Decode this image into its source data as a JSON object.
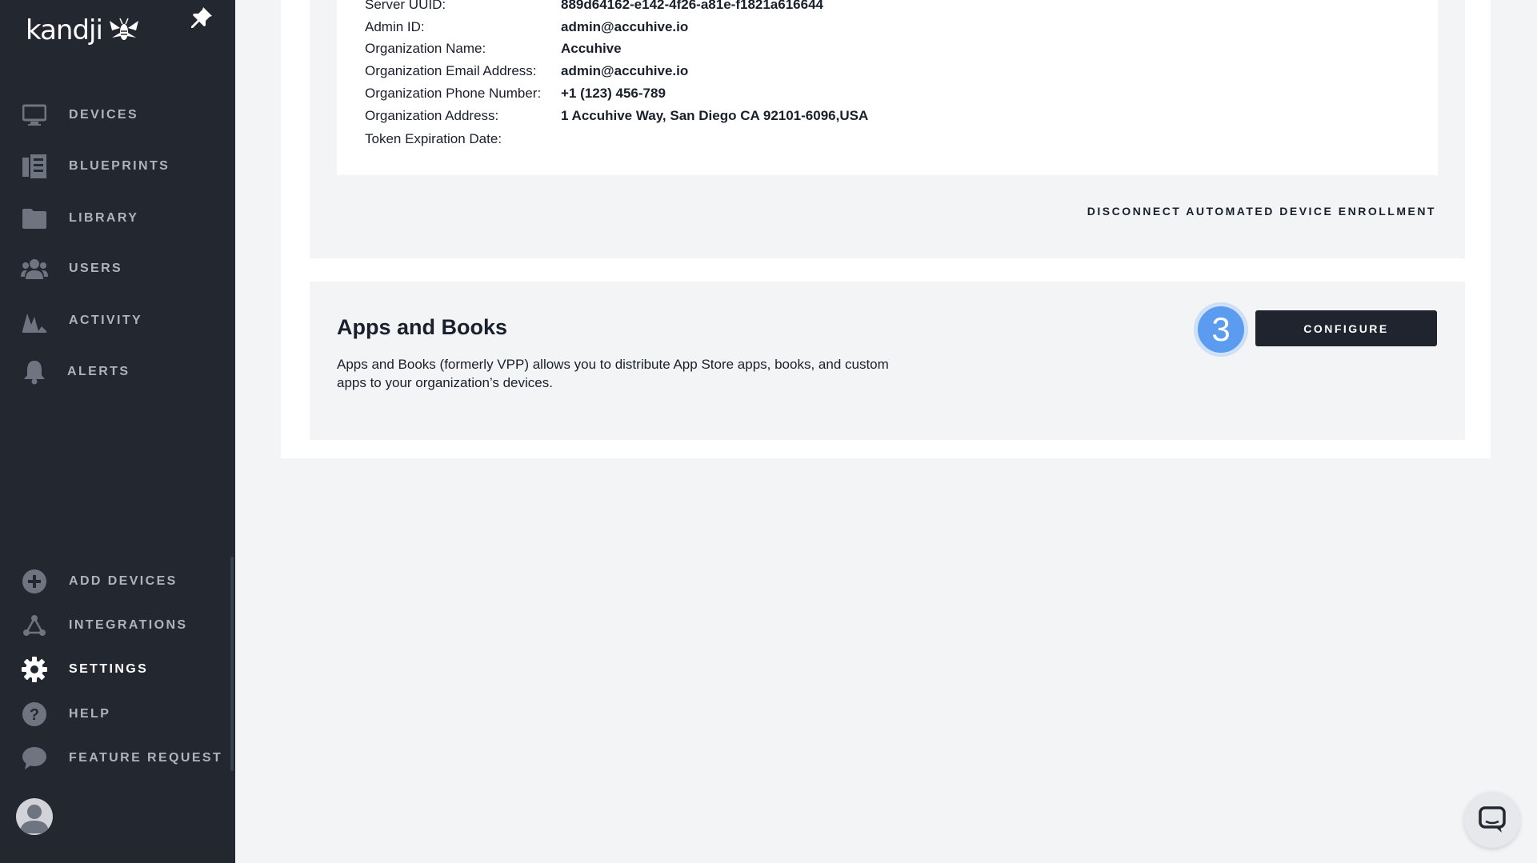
{
  "sidebar": {
    "logo_text": "kandji",
    "nav_top": [
      {
        "label": "Devices",
        "icon": "monitor-icon"
      },
      {
        "label": "Blueprints",
        "icon": "blueprints-icon"
      },
      {
        "label": "Library",
        "icon": "folder-icon"
      },
      {
        "label": "Users",
        "icon": "users-icon"
      },
      {
        "label": "Activity",
        "icon": "activity-icon"
      },
      {
        "label": "Alerts",
        "icon": "bell-icon"
      }
    ],
    "nav_bottom": [
      {
        "label": "Add Devices",
        "icon": "plus-circle-icon"
      },
      {
        "label": "Integrations",
        "icon": "integrations-icon"
      },
      {
        "label": "Settings",
        "icon": "gear-icon",
        "active": true
      },
      {
        "label": "Help",
        "icon": "help-icon"
      },
      {
        "label": "Feature Request",
        "icon": "speech-bubble-icon"
      }
    ]
  },
  "ade": {
    "details": [
      {
        "label": "Server UUID:",
        "value": "889d64162-e142-4f26-a81e-f1821a616644"
      },
      {
        "label": "Admin ID:",
        "value": "admin@accuhive.io"
      },
      {
        "label": "Organization Name:",
        "value": "Accuhive"
      },
      {
        "label": "Organization Email Address:",
        "value": "admin@accuhive.io"
      },
      {
        "label": "Organization Phone Number:",
        "value": "+1 (123) 456-789"
      },
      {
        "label": "Organization Address:",
        "value": "1 Accuhive Way, San Diego CA 92101-6096,USA"
      },
      {
        "label": "Token Expiration Date:",
        "value": ""
      }
    ],
    "disconnect_label": "DISCONNECT AUTOMATED DEVICE ENROLLMENT"
  },
  "apps_books": {
    "title": "Apps and Books",
    "description": "Apps and Books (formerly VPP) allows you to distribute App Store apps, books, and custom apps to your organization’s devices.",
    "step_number": "3",
    "configure_label": "CONFIGURE"
  },
  "colors": {
    "sidebar_bg": "#23272f",
    "accent_blue": "#5b9cf0",
    "button_dark": "#1f242e"
  }
}
